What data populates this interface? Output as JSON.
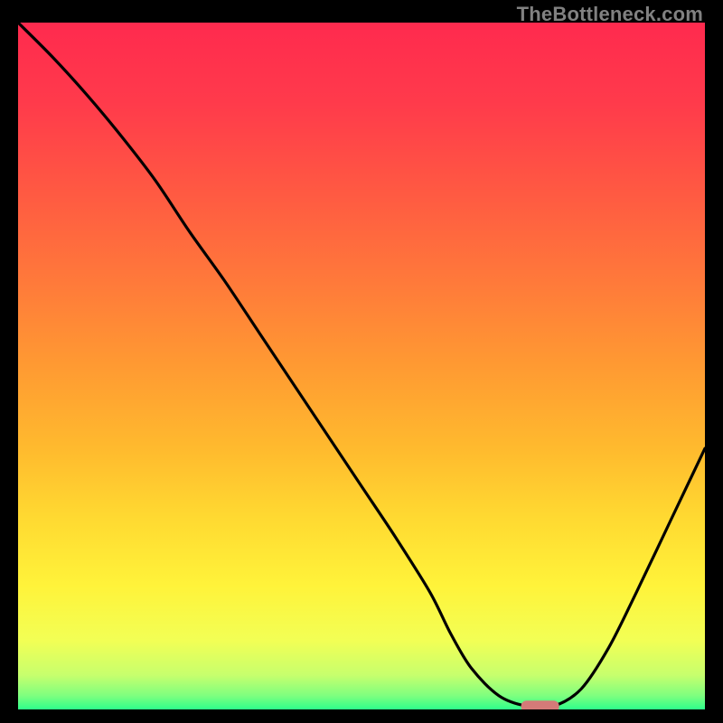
{
  "watermark": "TheBottleneck.com",
  "chart_data": {
    "type": "line",
    "title": "",
    "xlabel": "",
    "ylabel": "",
    "xlim": [
      0,
      100
    ],
    "ylim": [
      0,
      100
    ],
    "series": [
      {
        "name": "curve",
        "x": [
          0,
          5,
          10,
          15,
          20,
          25,
          30,
          35,
          40,
          45,
          50,
          55,
          60,
          63,
          66,
          70,
          74,
          78,
          82,
          86,
          90,
          95,
          100
        ],
        "y": [
          100,
          95,
          89.5,
          83.5,
          77,
          69.5,
          62.5,
          55,
          47.5,
          40,
          32.5,
          25,
          17,
          11,
          6,
          2,
          0.5,
          0.5,
          3,
          9,
          17,
          27.5,
          38
        ]
      }
    ],
    "marker": {
      "x": 76,
      "y": 0.5,
      "color": "#d47a78"
    },
    "gradient_stops": [
      {
        "offset": 0.0,
        "color": "#ff2a4e"
      },
      {
        "offset": 0.12,
        "color": "#ff3b4b"
      },
      {
        "offset": 0.25,
        "color": "#ff5a42"
      },
      {
        "offset": 0.38,
        "color": "#ff7a3a"
      },
      {
        "offset": 0.5,
        "color": "#ff9a32"
      },
      {
        "offset": 0.62,
        "color": "#ffba2e"
      },
      {
        "offset": 0.72,
        "color": "#ffd931"
      },
      {
        "offset": 0.82,
        "color": "#fff33a"
      },
      {
        "offset": 0.9,
        "color": "#f2ff55"
      },
      {
        "offset": 0.95,
        "color": "#c7ff6d"
      },
      {
        "offset": 0.98,
        "color": "#7eff7f"
      },
      {
        "offset": 1.0,
        "color": "#2eff8b"
      }
    ]
  }
}
